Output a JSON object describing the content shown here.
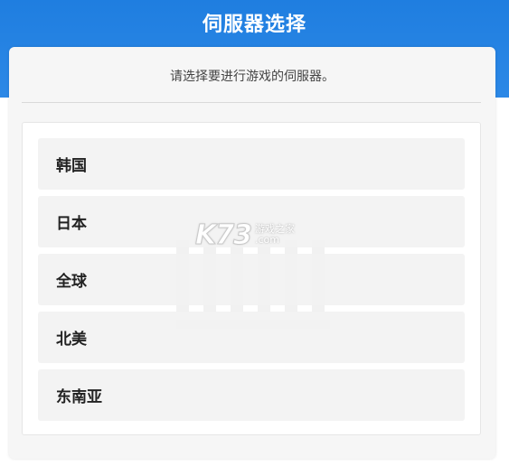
{
  "dialog": {
    "title": "伺服器选择",
    "prompt": "请选择要进行游戏的伺服器。"
  },
  "servers": [
    {
      "label": "韩国"
    },
    {
      "label": "日本"
    },
    {
      "label": "全球"
    },
    {
      "label": "北美"
    },
    {
      "label": "东南亚"
    }
  ],
  "watermark": {
    "brand": "K73",
    "line1": "游戏之家",
    "line2": ".com"
  },
  "colors": {
    "header_blue": "#1f7ee0",
    "panel_bg": "#f6f6f6",
    "item_bg": "#f2f2f2"
  }
}
